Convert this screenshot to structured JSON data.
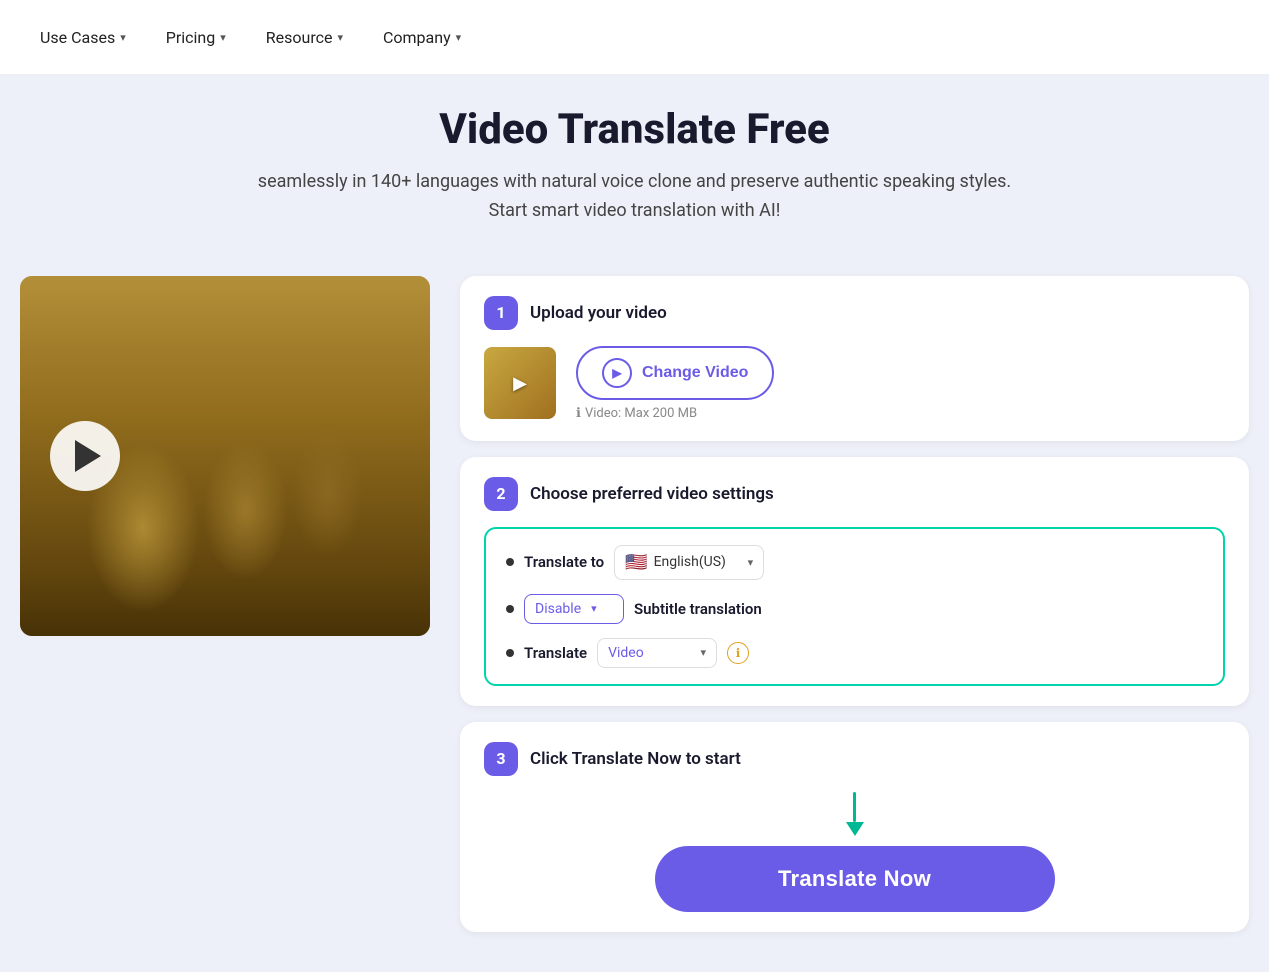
{
  "nav": {
    "items": [
      {
        "label": "Use Cases",
        "has_dropdown": true
      },
      {
        "label": "Pricing",
        "has_dropdown": true
      },
      {
        "label": "Resource",
        "has_dropdown": true
      },
      {
        "label": "Company",
        "has_dropdown": true
      }
    ]
  },
  "hero": {
    "title": "Video Translate Free",
    "subtitle": "seamlessly in 140+ languages with natural voice clone and preserve authentic speaking styles. Start smart video translation with AI!"
  },
  "step1": {
    "badge": "1",
    "title": "Upload your video",
    "change_video_label": "Change Video",
    "video_info": "Video: Max 200 MB"
  },
  "step2": {
    "badge": "2",
    "title": "Choose preferred video settings",
    "translate_to_label": "Translate to",
    "language": "English(US)",
    "subtitle_label": "Subtitle translation",
    "disable_label": "Disable",
    "translate_label": "Translate",
    "translate_type": "Video"
  },
  "step3": {
    "badge": "3",
    "title": "Click Translate Now to start",
    "button_label": "Translate Now"
  }
}
